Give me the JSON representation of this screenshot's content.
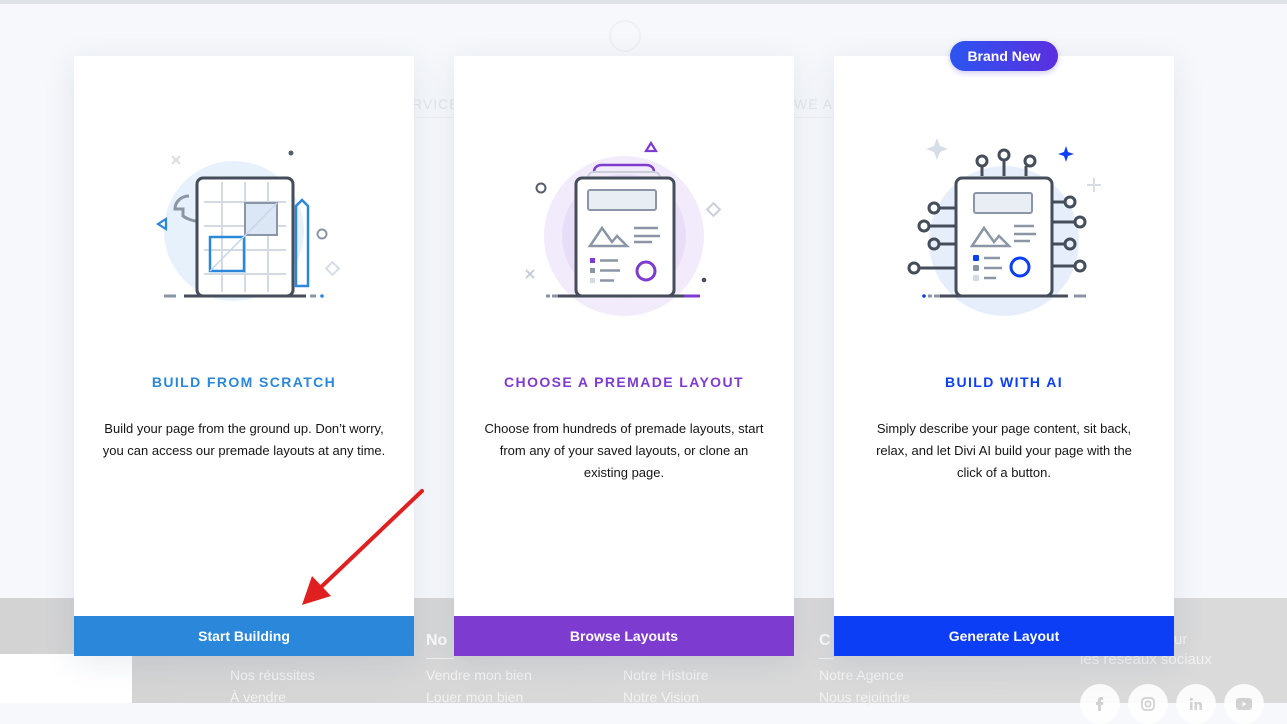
{
  "cards": [
    {
      "title": "BUILD FROM SCRATCH",
      "description": "Build your page from the ground up. Don’t worry, you can access our premade layouts at any time.",
      "button": "Start Building",
      "color": "#2b87da"
    },
    {
      "title": "CHOOSE A PREMADE LAYOUT",
      "description": "Choose from hundreds of premade layouts, start from any of your saved layouts, or clone an existing page.",
      "button": "Browse Layouts",
      "color": "#7e3bd0"
    },
    {
      "title": "BUILD WITH AI",
      "description": "Simply describe your page content, sit back, relax, and let Divi AI build your page with the click of a button.",
      "button": "Generate Layout",
      "color": "#0c3ef5",
      "badge": "Brand New",
      "badge_gradient": [
        "#2b55f0",
        "#5b2fe0"
      ]
    }
  ],
  "annotation": {
    "arrow_color": "#e02020",
    "target": "start-building-button"
  },
  "background_site": {
    "nav_fragments": [
      "RVICE",
      "WE AR"
    ],
    "footer_headings": [
      "No",
      "C",
      "ur",
      "les réseaux sociaux"
    ],
    "footer_columns": [
      [
        "Nos réussites",
        "À vendre"
      ],
      [
        "Vendre mon bien",
        "Louer mon bien"
      ],
      [
        "Notre Histoire",
        "Notre Vision"
      ],
      [
        "Notre Agence",
        "Nous rejoindre"
      ]
    ],
    "social_icons": [
      "facebook-icon",
      "instagram-icon",
      "linkedin-icon",
      "youtube-icon"
    ]
  }
}
